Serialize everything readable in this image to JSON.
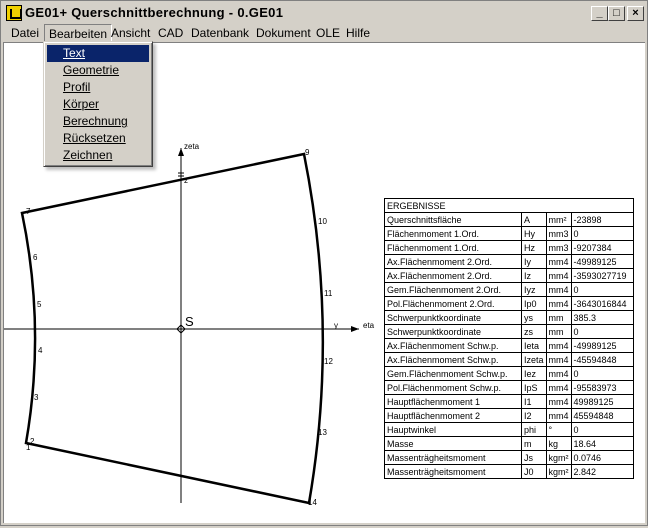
{
  "window": {
    "title": "GE01+ Querschnittberechnung - 0.GE01",
    "minimize_label": "_",
    "maximize_label": "□",
    "close_label": "×"
  },
  "menu": {
    "items": [
      "Datei",
      "Bearbeiten",
      "Ansicht",
      "CAD",
      "Datenbank",
      "Dokument",
      "OLE",
      "Hilfe"
    ],
    "active": "Bearbeiten"
  },
  "dropdown": {
    "items": [
      "Text",
      "Geometrie",
      "Profil",
      "Körper",
      "Berechnung",
      "Rücksetzen",
      "Zeichnen"
    ],
    "selected": "Text"
  },
  "drawing": {
    "axis_zeta": "zeta",
    "axis_eta": "eta",
    "axis_y": "y",
    "axis_z": "z",
    "center_label": "S",
    "node_labels": [
      "1",
      "2",
      "3",
      "4",
      "5",
      "6",
      "7",
      "9",
      "10",
      "11",
      "12",
      "13",
      "14"
    ],
    "outline_color": "#000000"
  },
  "results": {
    "header": "ERGEBNISSE",
    "rows": [
      [
        "Querschnittsfläche",
        "A",
        "mm²",
        "-23898"
      ],
      [
        "Flächenmoment 1.Ord.",
        "Hy",
        "mm3",
        "0"
      ],
      [
        "Flächenmoment 1.Ord.",
        "Hz",
        "mm3",
        "-9207384"
      ],
      [
        "Ax.Flächenmoment 2.Ord.",
        "Iy",
        "mm4",
        "-49989125"
      ],
      [
        "Ax.Flächenmoment 2.Ord.",
        "Iz",
        "mm4",
        "-3593027719"
      ],
      [
        "Gem.Flächenmoment 2.Ord.",
        "Iyz",
        "mm4",
        "0"
      ],
      [
        "Pol.Flächenmoment 2.Ord.",
        "Ip0",
        "mm4",
        "-3643016844"
      ],
      [
        "Schwerpunktkoordinate",
        "ys",
        "mm",
        "385.3"
      ],
      [
        "Schwerpunktkoordinate",
        "zs",
        "mm",
        "0"
      ],
      [
        "Ax.Flächenmoment Schw.p.",
        "Ieta",
        "mm4",
        "-49989125"
      ],
      [
        "Ax.Flächenmoment Schw.p.",
        "Izeta",
        "mm4",
        "-45594848"
      ],
      [
        "Gem.Flächenmoment Schw.p.",
        "Iez",
        "mm4",
        "0"
      ],
      [
        "Pol.Flächenmoment Schw.p.",
        "IpS",
        "mm4",
        "-95583973"
      ],
      [
        "Hauptflächenmoment 1",
        "I1",
        "mm4",
        "49989125"
      ],
      [
        "Hauptflächenmoment 2",
        "I2",
        "mm4",
        "45594848"
      ],
      [
        "Hauptwinkel",
        "phi",
        "°",
        "0"
      ],
      [
        "Masse",
        "m",
        "kg",
        "18.64"
      ],
      [
        "Massenträgheitsmoment",
        "Js",
        "kgm²",
        "0.0746"
      ],
      [
        "Massenträgheitsmoment",
        "J0",
        "kgm²",
        "2.842"
      ]
    ]
  }
}
